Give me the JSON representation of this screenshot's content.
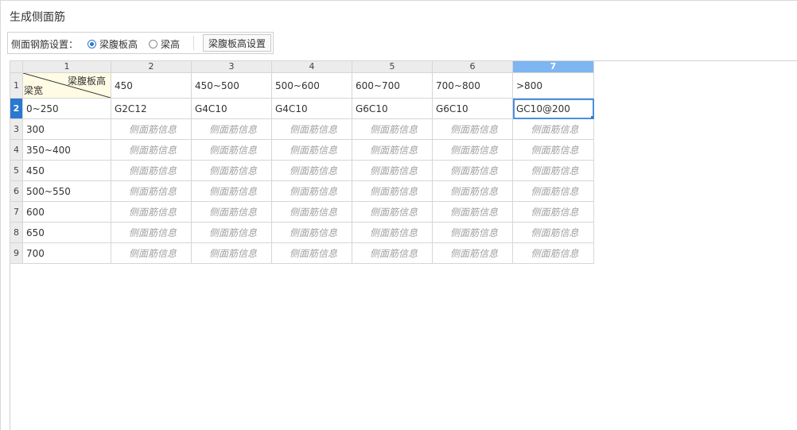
{
  "title": "生成侧面筋",
  "toolbar": {
    "label": "侧面钢筋设置：",
    "radio_web_height": "梁腹板高",
    "radio_beam_height": "梁高",
    "selected": "梁腹板高",
    "button": "梁腹板高设置"
  },
  "grid": {
    "col_headers": [
      "1",
      "2",
      "3",
      "4",
      "5",
      "6",
      "7"
    ],
    "selected_col": "7",
    "selected_row": "2",
    "corner": {
      "top_right": "梁腹板高",
      "bottom_left": "梁宽"
    },
    "web_heights": [
      "450",
      "450~500",
      "500~600",
      "600~700",
      "700~800",
      ">800"
    ],
    "row_numbers": [
      "1",
      "2",
      "3",
      "4",
      "5",
      "6",
      "7",
      "8",
      "9"
    ],
    "rows": [
      {
        "width": "0~250",
        "cells": [
          "G2C12",
          "G4C10",
          "G4C10",
          "G6C10",
          "G6C10",
          "GC10@200"
        ]
      },
      {
        "width": "300",
        "cells": [
          "",
          "",
          "",
          "",
          "",
          ""
        ]
      },
      {
        "width": "350~400",
        "cells": [
          "",
          "",
          "",
          "",
          "",
          ""
        ]
      },
      {
        "width": "450",
        "cells": [
          "",
          "",
          "",
          "",
          "",
          ""
        ]
      },
      {
        "width": "500~550",
        "cells": [
          "",
          "",
          "",
          "",
          "",
          ""
        ]
      },
      {
        "width": "600",
        "cells": [
          "",
          "",
          "",
          "",
          "",
          ""
        ]
      },
      {
        "width": "650",
        "cells": [
          "",
          "",
          "",
          "",
          "",
          ""
        ]
      },
      {
        "width": "700",
        "cells": [
          "",
          "",
          "",
          "",
          "",
          ""
        ]
      }
    ],
    "placeholder": "侧面筋信息"
  },
  "colors": {
    "accent": "#2b78d0",
    "header_selected": "#7db6f0",
    "corner_bg": "#fffbe4"
  }
}
